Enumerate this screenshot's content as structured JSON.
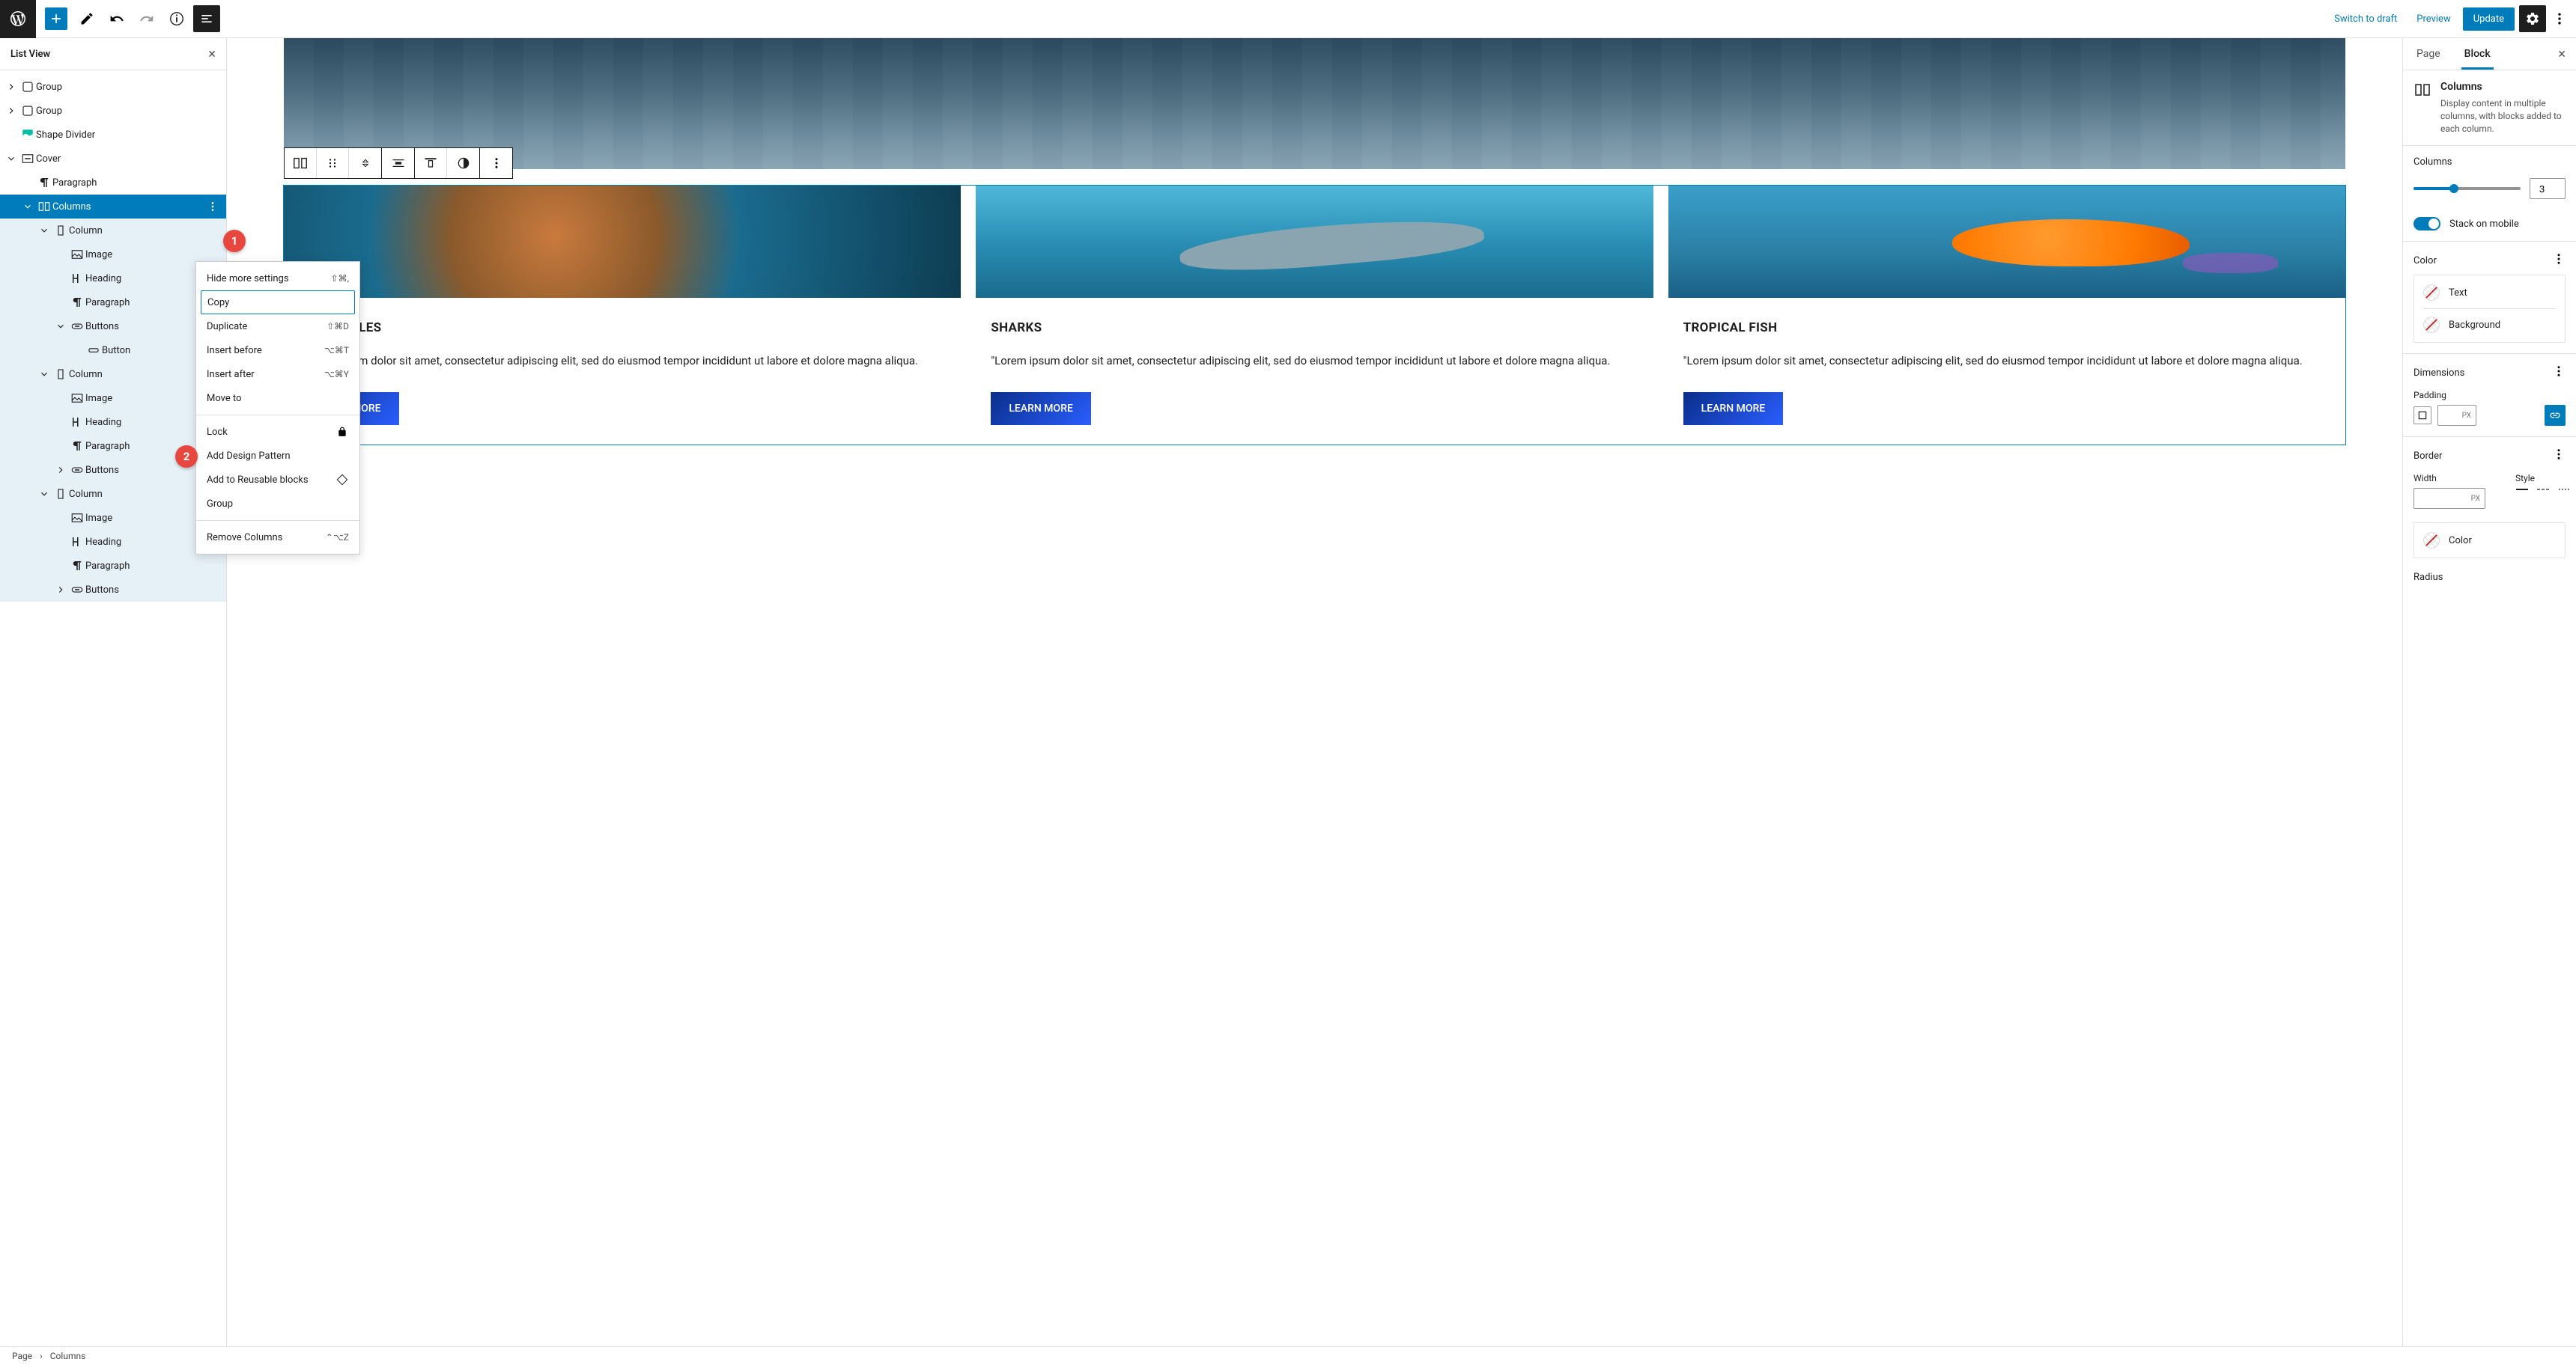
{
  "topbar": {
    "switch_to_draft": "Switch to draft",
    "preview": "Preview",
    "update": "Update"
  },
  "list_view": {
    "title": "List View",
    "items": [
      {
        "label": "Group",
        "icon": "group",
        "indent": 0,
        "toggle": "right"
      },
      {
        "label": "Group",
        "icon": "group",
        "indent": 0,
        "toggle": "right"
      },
      {
        "label": "Shape Divider",
        "icon": "shape-divider",
        "indent": 0,
        "toggle": ""
      },
      {
        "label": "Cover",
        "icon": "cover",
        "indent": 0,
        "toggle": "down"
      },
      {
        "label": "Paragraph",
        "icon": "paragraph",
        "indent": 1,
        "toggle": ""
      },
      {
        "label": "Columns",
        "icon": "columns",
        "indent": 1,
        "toggle": "down",
        "selected": true,
        "more": true
      },
      {
        "label": "Column",
        "icon": "column",
        "indent": 2,
        "toggle": "down",
        "child": true
      },
      {
        "label": "Image",
        "icon": "image",
        "indent": 3,
        "toggle": "",
        "child": true
      },
      {
        "label": "Heading",
        "icon": "heading",
        "indent": 3,
        "toggle": "",
        "child": true
      },
      {
        "label": "Paragraph",
        "icon": "paragraph",
        "indent": 3,
        "toggle": "",
        "child": true
      },
      {
        "label": "Buttons",
        "icon": "buttons",
        "indent": 3,
        "toggle": "down",
        "child": true
      },
      {
        "label": "Button",
        "icon": "button",
        "indent": 4,
        "toggle": "",
        "child": true
      },
      {
        "label": "Column",
        "icon": "column",
        "indent": 2,
        "toggle": "down",
        "child": true
      },
      {
        "label": "Image",
        "icon": "image",
        "indent": 3,
        "toggle": "",
        "child": true
      },
      {
        "label": "Heading",
        "icon": "heading",
        "indent": 3,
        "toggle": "",
        "child": true
      },
      {
        "label": "Paragraph",
        "icon": "paragraph",
        "indent": 3,
        "toggle": "",
        "child": true
      },
      {
        "label": "Buttons",
        "icon": "buttons",
        "indent": 3,
        "toggle": "right",
        "child": true
      },
      {
        "label": "Column",
        "icon": "column",
        "indent": 2,
        "toggle": "down",
        "child": true
      },
      {
        "label": "Image",
        "icon": "image",
        "indent": 3,
        "toggle": "",
        "child": true
      },
      {
        "label": "Heading",
        "icon": "heading",
        "indent": 3,
        "toggle": "",
        "child": true
      },
      {
        "label": "Paragraph",
        "icon": "paragraph",
        "indent": 3,
        "toggle": "",
        "child": true
      },
      {
        "label": "Buttons",
        "icon": "buttons",
        "indent": 3,
        "toggle": "right",
        "child": true
      }
    ]
  },
  "context_menu": {
    "hide_more": "Hide more settings",
    "hide_more_kbd": "⇧⌘,",
    "copy": "Copy",
    "duplicate": "Duplicate",
    "duplicate_kbd": "⇧⌘D",
    "insert_before": "Insert before",
    "insert_before_kbd": "⌥⌘T",
    "insert_after": "Insert after",
    "insert_after_kbd": "⌥⌘Y",
    "move_to": "Move to",
    "lock": "Lock",
    "add_design": "Add Design Pattern",
    "add_reusable": "Add to Reusable blocks",
    "group": "Group",
    "remove": "Remove Columns",
    "remove_kbd": "⌃⌥Z"
  },
  "callouts": {
    "c1": "1",
    "c2": "2"
  },
  "canvas": {
    "cards": [
      {
        "title": "SEA TURTLES",
        "text": "\"Lorem ipsum dolor sit amet, consectetur adipiscing elit, sed do eiusmod tempor incididunt ut labore et dolore magna aliqua.",
        "button": "LEARN MORE",
        "img": "turtle"
      },
      {
        "title": "SHARKS",
        "text": "\"Lorem ipsum dolor sit amet, consectetur adipiscing elit, sed do eiusmod tempor incididunt ut labore et dolore magna aliqua.",
        "button": "LEARN MORE",
        "img": "shark"
      },
      {
        "title": "TROPICAL FISH",
        "text": "\"Lorem ipsum dolor sit amet, consectetur adipiscing elit, sed do eiusmod tempor incididunt ut labore et dolore magna aliqua.",
        "button": "LEARN MORE",
        "img": "fish"
      }
    ]
  },
  "sidebar": {
    "tab_page": "Page",
    "tab_block": "Block",
    "block_title": "Columns",
    "block_desc": "Display content in multiple columns, with blocks added to each column.",
    "columns_label": "Columns",
    "columns_value": "3",
    "stack_label": "Stack on mobile",
    "color_label": "Color",
    "text_label": "Text",
    "bg_label": "Background",
    "dimensions_label": "Dimensions",
    "padding_label": "Padding",
    "px": "PX",
    "border_label": "Border",
    "width_label": "Width",
    "style_label": "Style",
    "border_color_label": "Color",
    "radius_label": "Radius"
  },
  "breadcrumb": {
    "page": "Page",
    "sep": "›",
    "current": "Columns"
  }
}
